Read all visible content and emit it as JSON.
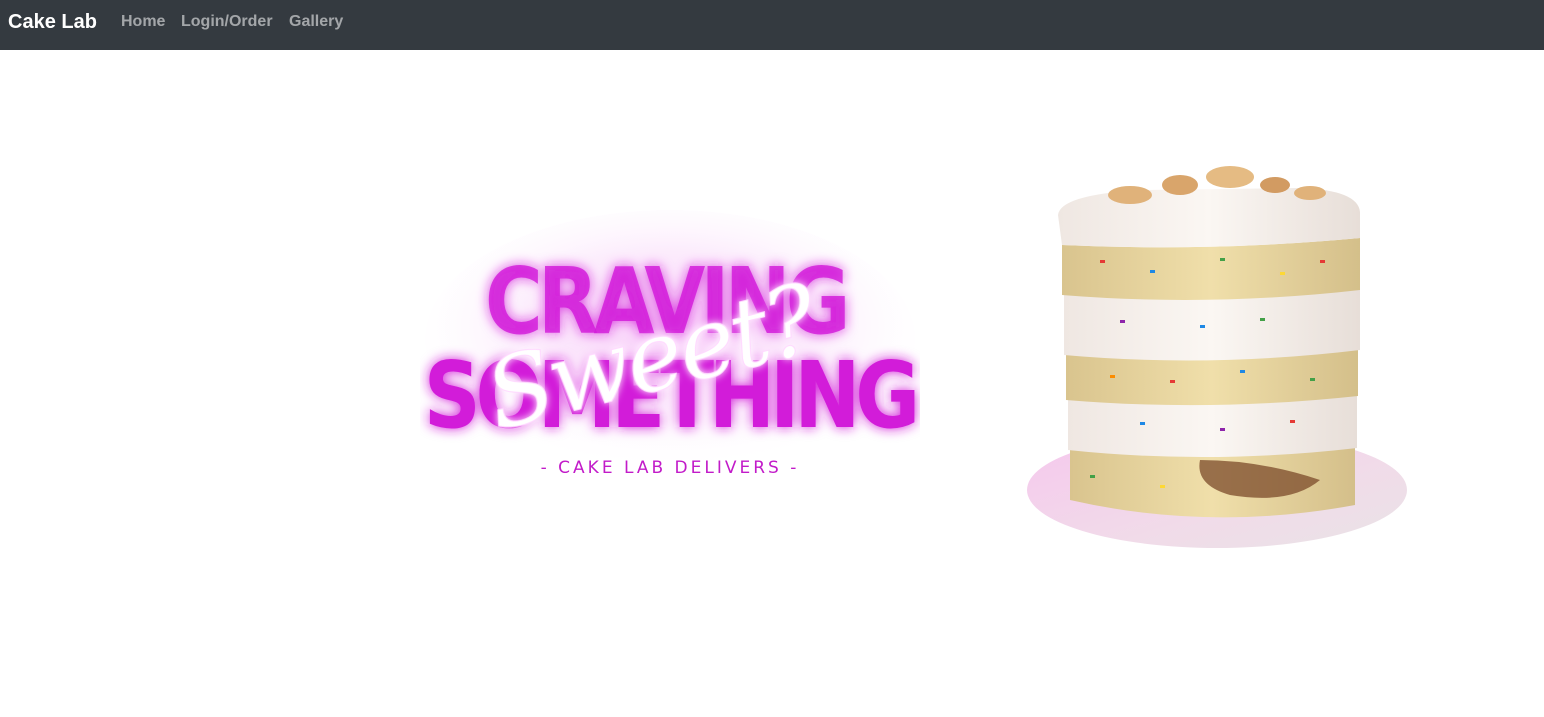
{
  "navbar": {
    "brand": "Cake Lab",
    "links": [
      {
        "label": "Home"
      },
      {
        "label": "Login/Order"
      },
      {
        "label": "Gallery"
      }
    ],
    "background_color": "#343a40"
  },
  "hero": {
    "logo": {
      "line1": "CRAVING",
      "line2": "SOMETHING",
      "script": "Sweet?",
      "tagline": "- CAKE LAB DELIVERS -",
      "accent_color": "#cc1fd6"
    },
    "cake_image": {
      "icon": "layered-cake-image"
    }
  }
}
